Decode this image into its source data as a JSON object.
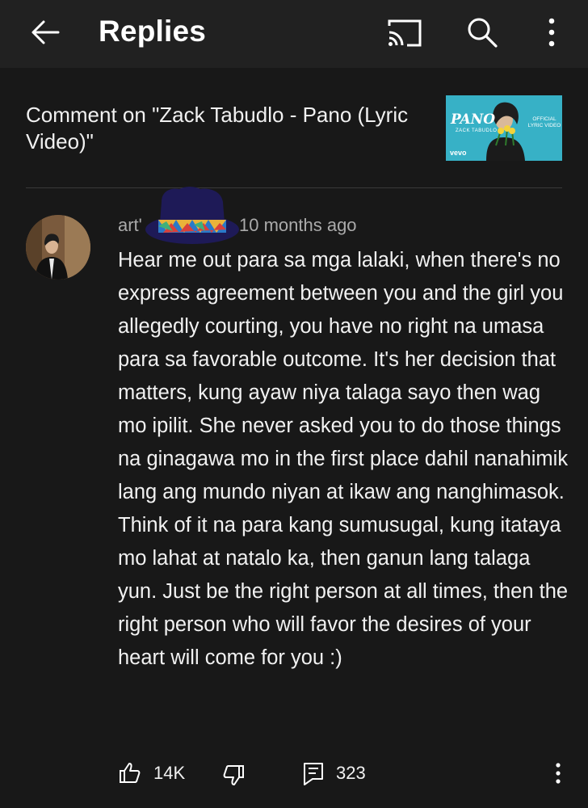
{
  "header": {
    "title": "Replies",
    "icons": [
      "back-arrow-icon",
      "cast-icon",
      "search-icon",
      "more-vert-icon"
    ]
  },
  "video": {
    "comment_on": "Comment on \"Zack Tabudlo - Pano (Lyric Video)\"",
    "thumbnail": {
      "title": "PANO",
      "artist": "ZACK TABUDLO",
      "badge": "OFFICIAL LYRIC VIDEO",
      "label": "vevo"
    }
  },
  "comment": {
    "author": "art'",
    "time": "10 months ago",
    "text": "Hear me out para sa mga lalaki, when there's no express agreement between you and the girl you allegedly courting, you have no right na umasa para sa favorable outcome. It's her decision that matters, kung ayaw niya talaga sayo then wag mo ipilit. She never asked you to do those things na ginagawa mo in the first place dahil nanahimik lang ang mundo niyan at ikaw ang nanghimasok. Think of it na para kang sumusugal, kung itataya mo lahat at natalo ka, then ganun lang talaga yun. Just be the right person at all times, then the right person who will favor the desires of your heart will come for you :)",
    "likes": "14K",
    "replies": "323"
  },
  "colors": {
    "background": "#181818",
    "topbar": "#212121",
    "text": "#f1f1f1",
    "secondary_text": "#aaaaaa",
    "thumbnail_bg": "#37b1c6"
  }
}
